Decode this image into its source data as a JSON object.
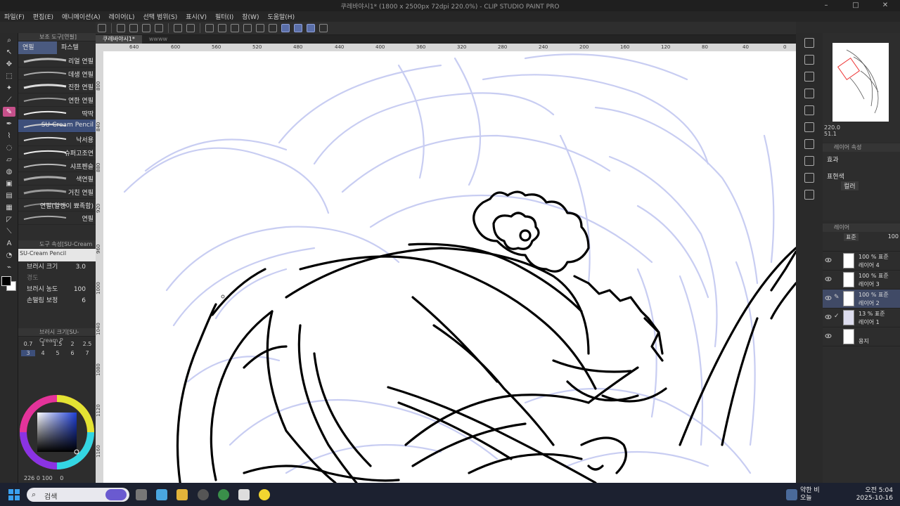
{
  "window": {
    "title": "쿠레바야시1* (1800 x 2500px 72dpi 220.0%) - CLIP STUDIO PAINT PRO"
  },
  "menu": [
    "파일(F)",
    "편집(E)",
    "애니메이션(A)",
    "레이어(L)",
    "선택 범위(S)",
    "표시(V)",
    "필터(I)",
    "창(W)",
    "도움말(H)"
  ],
  "subtool": {
    "panel_title": "보조 도구[연필]",
    "tabs": [
      "연필",
      "파스텔"
    ],
    "brushes": [
      "리얼 연필",
      "데생 연필",
      "진한 연필",
      "연한 연필",
      "딱딱",
      "SU-Cream Pencil",
      "낙서용",
      "슈퍼고조연",
      "샤프펜슬",
      "색연필",
      "거친 연필",
      "연필(알갱이 뾰족함)",
      "연필"
    ],
    "selected": "SU-Cream Pencil"
  },
  "tool_property": {
    "panel_title": "도구 속성[SU-Cream Pencil]",
    "brush_name": "SU-Cream Pencil",
    "brush_size_label": "브러시 크기",
    "brush_size_value": "3.0",
    "hardness_label": "경도",
    "density_label": "브러시 농도",
    "density_value": "100",
    "stabilization_label": "손떨림 보정",
    "stabilization_value": "6"
  },
  "brush_size_panel": {
    "title": "브러시 크기[SU-Cream P",
    "sizes": [
      "0.7",
      "1",
      "1.5",
      "2",
      "2.5",
      "3",
      "4",
      "5",
      "6",
      "7"
    ],
    "selected": "3"
  },
  "color": {
    "readout": "226 0 100",
    "extra": "0",
    "foreground": "#000000",
    "background": "#ffffff"
  },
  "tabs": [
    "쿠레바야시1*",
    "ᴡᴡᴡᴡ"
  ],
  "ruler_top": [
    "640",
    "600",
    "560",
    "520",
    "480",
    "440",
    "400",
    "360",
    "320",
    "280",
    "240",
    "200",
    "160",
    "120",
    "80",
    "40",
    "0"
  ],
  "ruler_left": [
    "800",
    "840",
    "880",
    "920",
    "960",
    "1000",
    "1040",
    "1080",
    "1120",
    "1160"
  ],
  "navigator": {
    "zoom": "220.0",
    "angle": "51.1"
  },
  "layer_property": {
    "title": "레이어 속성",
    "effect_label": "효과",
    "expression_label": "표현색",
    "expression_value": "컬러"
  },
  "layers": {
    "title": "레이어",
    "blend_mode": "표준",
    "opacity": "100",
    "items": [
      {
        "opacity": "100 % 표준",
        "name": "레이어 4",
        "selected": false
      },
      {
        "opacity": "100 % 표준",
        "name": "레이어 3",
        "selected": false
      },
      {
        "opacity": "100 % 표준",
        "name": "레이어 2",
        "selected": true
      },
      {
        "opacity": "13 % 표준",
        "name": "레이어 1",
        "selected": false
      },
      {
        "opacity": "",
        "name": "용지",
        "selected": false
      }
    ]
  },
  "taskbar": {
    "search_placeholder": "검색",
    "weather": "약한 비",
    "weather_sub": "오늘",
    "time": "오전 5:04",
    "date": "2025-10-16"
  },
  "colors": {
    "accent": "#c6508a",
    "selection": "#3d4f7a",
    "sketch": "#c8cdf2"
  }
}
